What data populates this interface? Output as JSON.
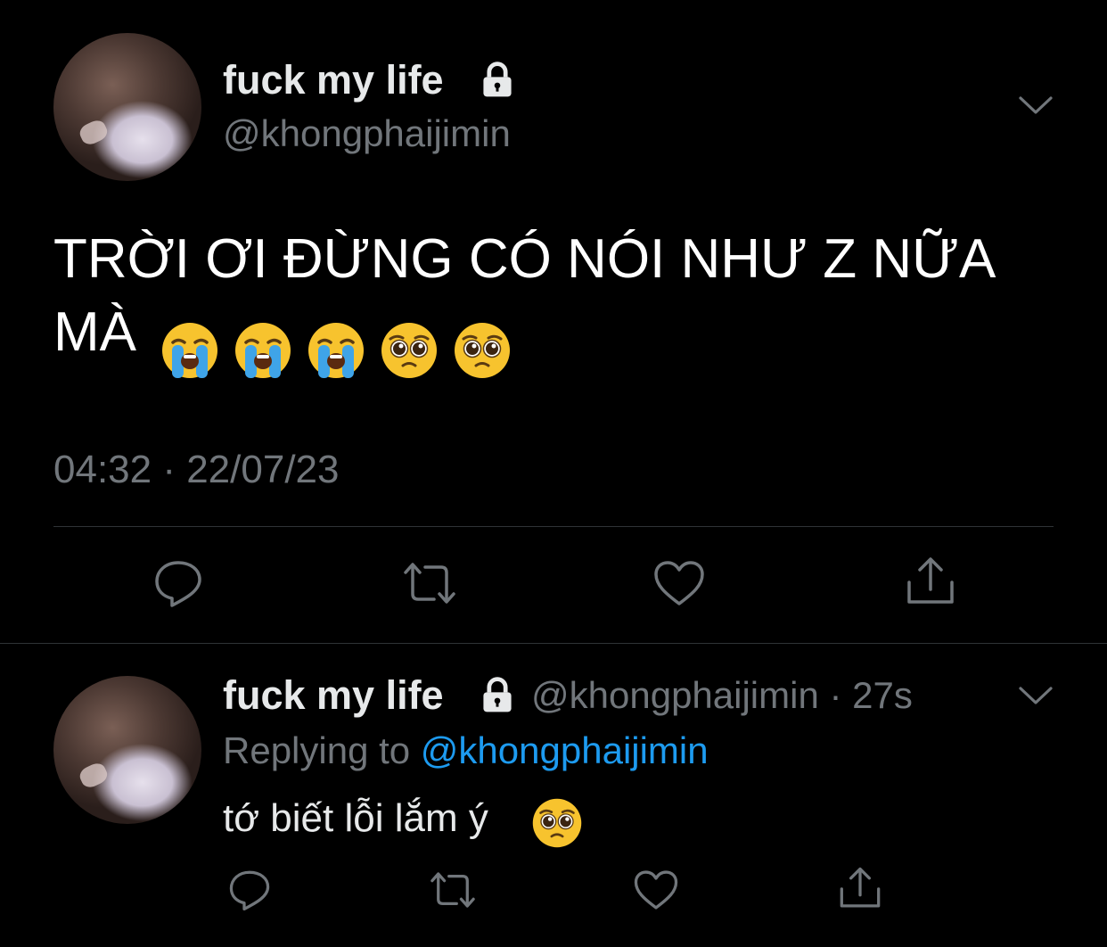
{
  "main_tweet": {
    "display_name": "fuck my life",
    "handle": "@khongphaijimin",
    "text_line1": "TRỜI ƠI ĐỪNG CÓ NÓI NHƯ Z NỮA",
    "text_line2": "MÀ",
    "emojis": [
      "loudly-crying-face",
      "loudly-crying-face",
      "loudly-crying-face",
      "pleading-face",
      "pleading-face"
    ],
    "timestamp": "04:32 · 22/07/23",
    "actions": [
      "reply-icon",
      "retweet-icon",
      "like-icon",
      "share-icon"
    ]
  },
  "reply_tweet": {
    "display_name": "fuck my life",
    "handle_time": "@khongphaijimin · 27s",
    "replying_prefix": "Replying to ",
    "replying_mention": "@khongphaijimin",
    "text": "tớ biết lỗi lắm ý",
    "emojis": [
      "pleading-face"
    ],
    "actions": [
      "reply-icon",
      "retweet-icon",
      "like-icon",
      "share-icon"
    ]
  },
  "colors": {
    "background": "#000000",
    "primary_text": "#e7e9ea",
    "secondary_text": "#71767b",
    "accent": "#1d9bf0",
    "divider": "#2f3336"
  }
}
